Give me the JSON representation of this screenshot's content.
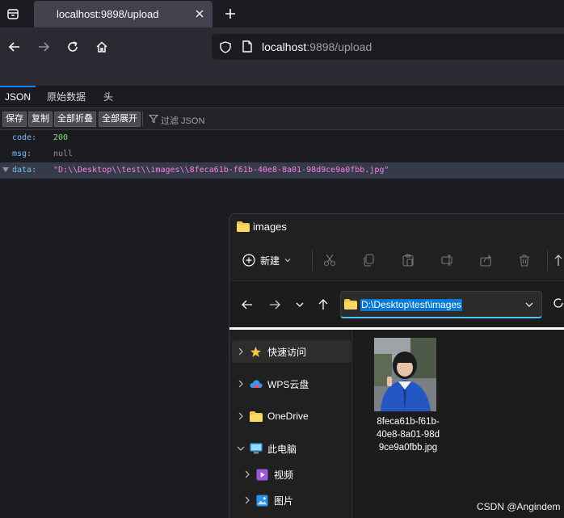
{
  "browser": {
    "tab_title": "localhost:9898/upload",
    "url_host": "localhost",
    "url_rest": ":9898/upload"
  },
  "json_viewer": {
    "tabs": [
      "JSON",
      "原始数据",
      "头"
    ],
    "toolbar": {
      "save": "保存",
      "copy": "复制",
      "collapse_all": "全部折叠",
      "expand_all": "全部展开",
      "filter_placeholder": "过滤 JSON"
    },
    "rows": [
      {
        "key": "code:",
        "value": "200",
        "color": "#86de74"
      },
      {
        "key": "msg:",
        "value": "null",
        "color": "#939395"
      },
      {
        "key": "data:",
        "value": "\"D:\\\\Desktop\\\\test\\\\images\\\\8feca61b-f61b-40e8-8a01-98d9ce9a0fbb.jpg\"",
        "color": "#ff7de9"
      }
    ]
  },
  "explorer": {
    "window_title": "images",
    "new_label": "新建",
    "address": "D:\\Desktop\\test\\images",
    "nav_items": [
      "快速访问",
      "WPS云盘",
      "OneDrive",
      "此电脑",
      "视频",
      "图片"
    ],
    "file": {
      "name_lines": [
        "8feca61b-f61b-",
        "40e8-8a01-98d",
        "9ce9a0fbb.jpg"
      ]
    }
  },
  "watermark": "CSDN @Angindem",
  "colors": {
    "accent_blue": "#0a84ff",
    "selection_blue": "#0078d4",
    "folder_yellow": "#f8c747"
  }
}
